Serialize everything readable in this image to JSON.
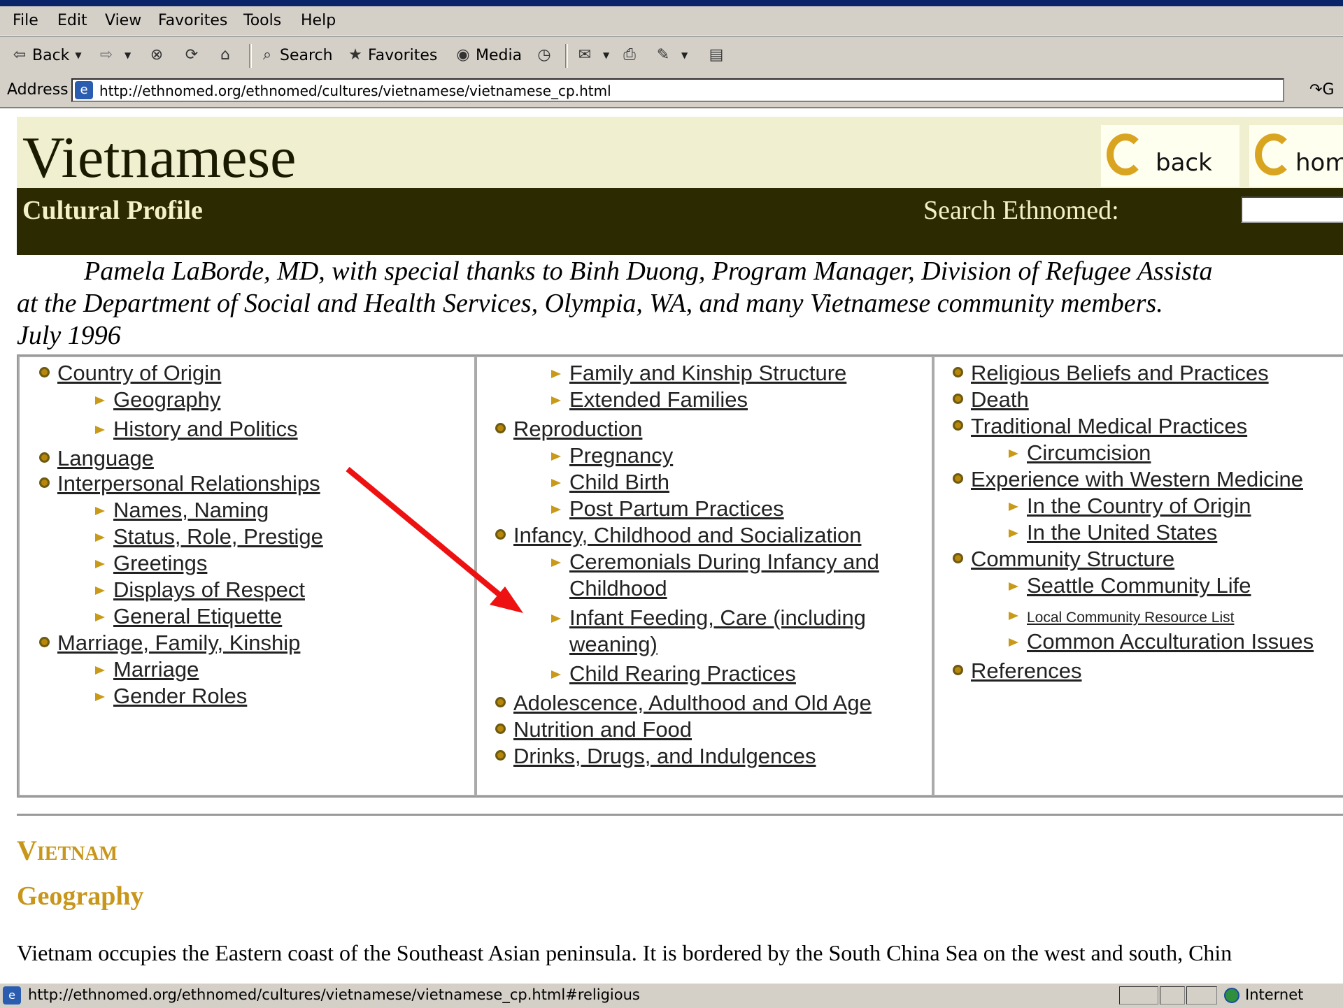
{
  "menu": [
    "File",
    "Edit",
    "View",
    "Favorites",
    "Tools",
    "Help"
  ],
  "toolbar": {
    "back": "Back",
    "search": "Search",
    "favorites": "Favorites",
    "media": "Media"
  },
  "address": {
    "label": "Address",
    "url": "http://ethnomed.org/ethnomed/cultures/vietnamese/vietnamese_cp.html",
    "go": "G"
  },
  "page": {
    "title": "Vietnamese",
    "back_btn": "back",
    "home_btn": "hom",
    "section_label": "Cultural Profile",
    "search_label": "Search Ethnomed:",
    "credit": "Pamela LaBorde, MD, with special thanks to Binh Duong, Program Manager, Division of Refugee Assista\nat the Department of Social and Health Services, Olympia, WA, and many Vietnamese community members.\nJuly 1996"
  },
  "toc": {
    "col1": [
      {
        "label": "Country of Origin",
        "level": 1
      },
      {
        "label": "Geography",
        "level": 2
      },
      {
        "label": "History and Politics",
        "level": 2
      },
      {
        "label": "Language",
        "level": 1
      },
      {
        "label": "Interpersonal Relationships",
        "level": 1
      },
      {
        "label": "Names, Naming",
        "level": 2
      },
      {
        "label": "Status, Role, Prestige",
        "level": 2
      },
      {
        "label": "Greetings",
        "level": 2
      },
      {
        "label": "Displays of Respect",
        "level": 2
      },
      {
        "label": "General Etiquette",
        "level": 2
      },
      {
        "label": "Marriage, Family, Kinship",
        "level": 1
      },
      {
        "label": "Marriage",
        "level": 2
      },
      {
        "label": "Gender Roles",
        "level": 2
      }
    ],
    "col2": [
      {
        "label": "Family and Kinship Structure",
        "level": 2
      },
      {
        "label": "Extended Families",
        "level": 2
      },
      {
        "label": "Reproduction",
        "level": 1
      },
      {
        "label": "Pregnancy",
        "level": 2
      },
      {
        "label": "Child Birth",
        "level": 2
      },
      {
        "label": "Post Partum Practices",
        "level": 2
      },
      {
        "label": "Infancy, Childhood and Socialization",
        "level": 1
      },
      {
        "label": "Ceremonials During Infancy and",
        "level": 2
      },
      {
        "label": "Childhood",
        "level": 3
      },
      {
        "label": "Infant Feeding, Care (including",
        "level": 2
      },
      {
        "label": "weaning)",
        "level": 3
      },
      {
        "label": "Child Rearing Practices",
        "level": 2
      },
      {
        "label": "Adolescence, Adulthood and Old Age",
        "level": 1
      },
      {
        "label": "Nutrition and Food",
        "level": 1
      },
      {
        "label": "Drinks, Drugs, and Indulgences",
        "level": 1
      }
    ],
    "col3": [
      {
        "label": "Religious Beliefs and Practices",
        "level": 1
      },
      {
        "label": "Death",
        "level": 1
      },
      {
        "label": "Traditional Medical Practices",
        "level": 1
      },
      {
        "label": "Circumcision",
        "level": 2
      },
      {
        "label": "Experience with Western Medicine",
        "level": 1
      },
      {
        "label": "In the Country of Origin",
        "level": 2
      },
      {
        "label": "In the United States",
        "level": 2
      },
      {
        "label": "Community Structure",
        "level": 1
      },
      {
        "label": "Seattle Community Life",
        "level": 2
      },
      {
        "label": "Local Community Resource List",
        "level": 2
      },
      {
        "label": "Common Acculturation Issues",
        "level": 2
      },
      {
        "label": "References",
        "level": 1
      }
    ]
  },
  "content": {
    "heading": "Vietnam",
    "subheading": "Geography",
    "body": "Vietnam occupies the Eastern coast of the Southeast Asian peninsula. It is bordered by the South China Sea on the west and south, Chin"
  },
  "status": {
    "url": "http://ethnomed.org/ethnomed/cultures/vietnamese/vietnamese_cp.html#religious",
    "zone": "Internet"
  },
  "colors": {
    "header_bg": "#f0f0d0",
    "darkbar_bg": "#2b2a00",
    "accent_gold": "#c8961a",
    "arrow_red": "#ee1111"
  }
}
